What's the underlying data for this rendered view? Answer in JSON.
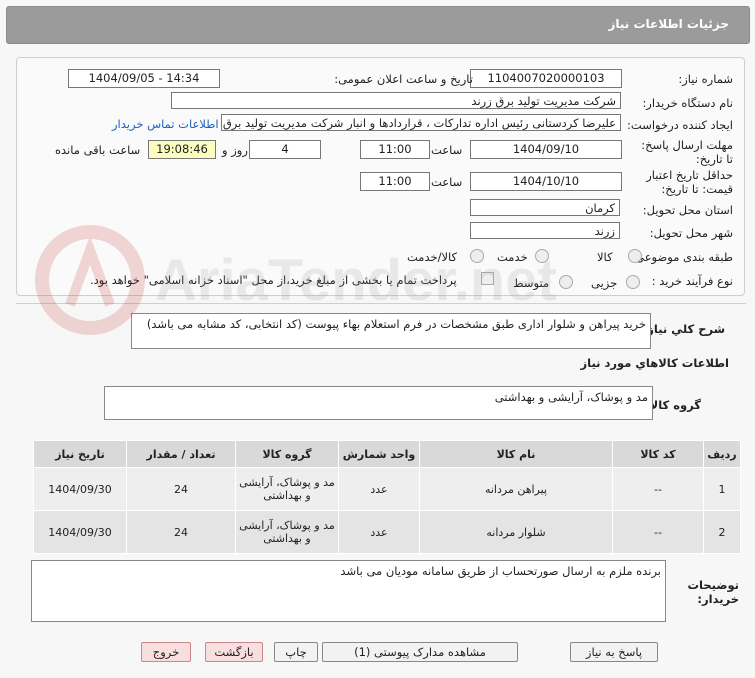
{
  "header": {
    "title": "جزئیات اطلاعات نیاز"
  },
  "labels": {
    "need_number": "شماره نیاز:",
    "announce_datetime": "تاریخ و ساعت اعلان عمومی:",
    "buyer_org": "نام دستگاه خریدار:",
    "requester": "ایجاد کننده درخواست:",
    "contact_link": "اطلاعات تماس خریدار",
    "send_deadline": "مهلت ارسال پاسخ: تا تاریخ:",
    "time": "ساعت",
    "days_and": "روز و",
    "remaining": "ساعت باقی مانده",
    "min_validity": "حداقل تاریخ اعتبار قیمت: تا تاریخ:",
    "province": "استان محل تحویل:",
    "city": "شهر محل تحویل:",
    "category": "طبقه بندی موضوعی:",
    "cat_goods": "کالا",
    "cat_service": "خدمت",
    "cat_goods_service": "کالا/خدمت",
    "process_type": "نوع فرآیند خرید :",
    "proc_partial": "جزیی",
    "proc_medium": "متوسط",
    "payment_note": "پرداخت تمام یا بخشی از مبلغ خرید،از محل \"اسناد خزانه اسلامی\" خواهد بود.",
    "general_desc": "شرح کلي نياز:",
    "goods_info": "اطلاعات کالاهاي مورد نياز",
    "goods_group": "گروه کالا:",
    "buyer_notes": "توضیحات خریدار:"
  },
  "values": {
    "need_number": "1104007020000103",
    "announce_datetime": "1404/09/05 - 14:34",
    "buyer_org": "شرکت مدیریت تولید برق زرند",
    "requester": "علیرضا کردستانی رئیس اداره تدارکات ، قراردادها و انبار  شرکت مدیریت تولید برق",
    "send_date": "1404/09/10",
    "send_time": "11:00",
    "days": "4",
    "remaining_time": "19:08:46",
    "validity_date": "1404/10/10",
    "validity_time": "11:00",
    "province": "کرمان",
    "city": "زرند",
    "general_desc": "خرید پیراهن و شلوار اداری طبق مشخصات در فرم استعلام بهاء پیوست (کد انتخابی، کد مشابه می باشد)",
    "goods_group": "مد و پوشاک، آرایشی و بهداشتی",
    "buyer_notes": "برنده ملزم به ارسال صورتحساب از طریق سامانه مودیان می باشد"
  },
  "table": {
    "headers": [
      "ردیف",
      "کد کالا",
      "نام کالا",
      "واحد شمارش",
      "گروه کالا",
      "تعداد / مقدار",
      "تاریخ نیاز"
    ],
    "rows": [
      [
        "1",
        "--",
        "پیراهن مردانه",
        "عدد",
        "مد و پوشاک، آرایشی و بهداشتی",
        "24",
        "1404/09/30"
      ],
      [
        "2",
        "--",
        "شلوار مردانه",
        "عدد",
        "مد و پوشاک، آرایشی و بهداشتی",
        "24",
        "1404/09/30"
      ]
    ]
  },
  "buttons": {
    "reply": "پاسخ به نیاز",
    "view_docs": "مشاهده مدارک پیوستی (1)",
    "print": "چاپ",
    "back": "بازگشت",
    "exit": "خروج"
  },
  "watermark": {
    "text": "AriaTender.net"
  },
  "colors": {
    "header": "#9b9b9b",
    "link": "#2060c0",
    "remaining_bg": "#fdfdc0",
    "pink_button": "#f8dede"
  }
}
